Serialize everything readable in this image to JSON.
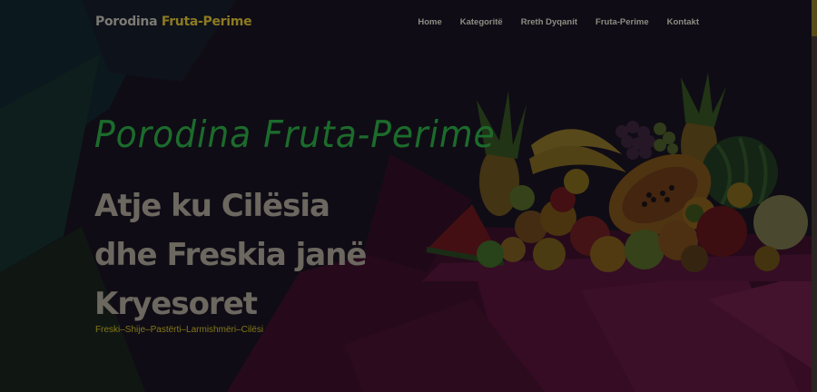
{
  "header": {
    "brand_part1": "Porodina",
    "brand_part2": "Fruta-Perime",
    "nav": [
      "Home",
      "Kategoritë",
      "Rreth Dyqanit",
      "Fruta-Perime",
      "Kontakt"
    ]
  },
  "hero": {
    "script_title": "Porodina Fruta-Perime",
    "title_lines": [
      "Atje ku Cilësia",
      "dhe Freskia janë",
      "Kryesoret"
    ],
    "tagline": "Freski–Shije–Pastërti–Larmishmëri–Cilësi"
  },
  "colors": {
    "accent_yellow": "#8c7a22",
    "accent_green": "#1c6b2c",
    "background_pink": "#5e1038"
  }
}
